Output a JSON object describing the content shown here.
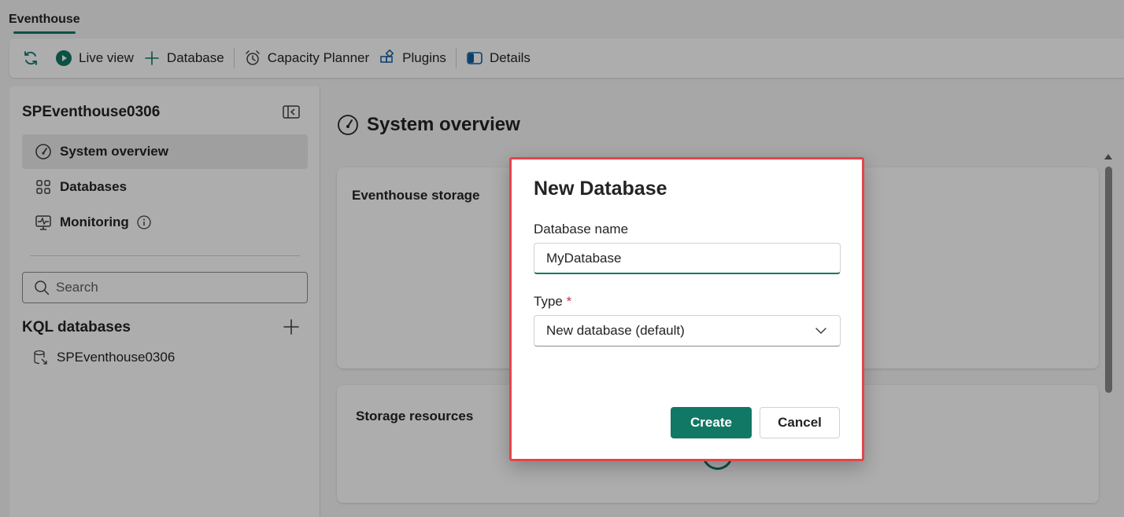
{
  "tabbar": {
    "tab_label": "Eventhouse"
  },
  "toolbar": {
    "items": [
      {
        "label": "",
        "icon": "refresh-icon"
      },
      {
        "label": "Live view",
        "icon": "play-icon"
      },
      {
        "label": "Database",
        "icon": "plus-icon"
      },
      {
        "label": "Capacity Planner",
        "icon": "alarm-clock-icon"
      },
      {
        "label": "Plugins",
        "icon": "puzzle-icon"
      },
      {
        "label": "Details",
        "icon": "panel-icon"
      }
    ]
  },
  "sidebar": {
    "title": "SPEventhouse0306",
    "nav": [
      {
        "label": "System overview",
        "icon": "gauge-icon",
        "active": true
      },
      {
        "label": "Databases",
        "icon": "grid-icon",
        "active": false
      },
      {
        "label": "Monitoring",
        "icon": "monitor-icon",
        "active": false
      }
    ],
    "search_placeholder": "Search",
    "kql_title": "KQL databases",
    "kql_items": [
      "SPEventhouse0306"
    ]
  },
  "main": {
    "title": "System overview",
    "cards": [
      {
        "title": "Eventhouse storage"
      },
      {
        "title": "Storage resources"
      }
    ]
  },
  "dialog": {
    "title": "New Database",
    "name_label": "Database name",
    "name_value": "MyDatabase",
    "type_label": "Type",
    "type_required_mark": "*",
    "type_value": "New database (default)",
    "create_label": "Create",
    "cancel_label": "Cancel"
  },
  "colors": {
    "accent": "#117865",
    "dialog_highlight": "#e3454a"
  }
}
